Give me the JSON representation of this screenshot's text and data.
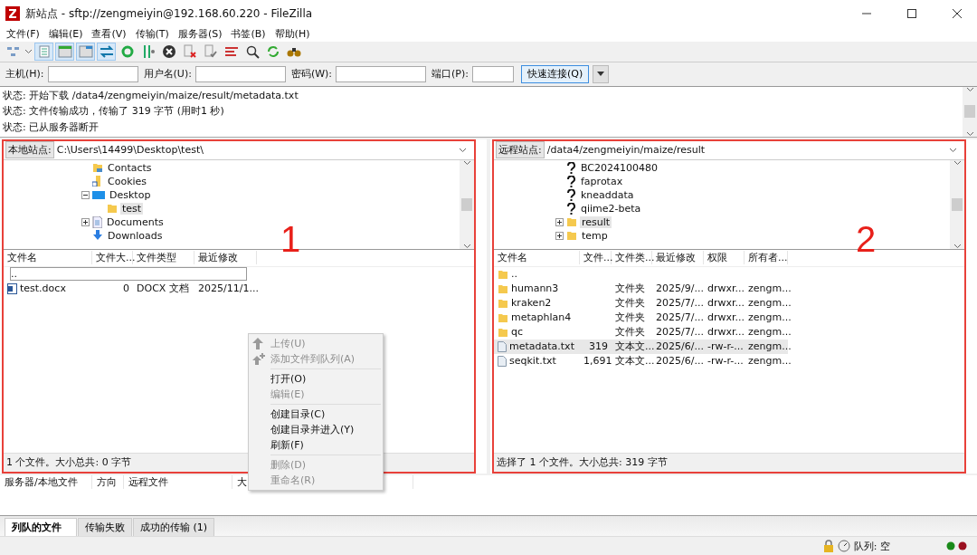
{
  "window": {
    "title": "新站点 - sftp://zengmeiyin@192.168.60.220 - FileZilla"
  },
  "menu": [
    "文件(F)",
    "编辑(E)",
    "查看(V)",
    "传输(T)",
    "服务器(S)",
    "书签(B)",
    "帮助(H)"
  ],
  "quickconnect": {
    "fields": [
      {
        "label": "主机(H):"
      },
      {
        "label": "用户名(U):"
      },
      {
        "label": "密码(W):"
      },
      {
        "label": "端口(P):"
      }
    ],
    "button": "快速连接(Q)"
  },
  "log": [
    "状态: 开始下载 /data4/zengmeiyin/maize/result/metadata.txt",
    "状态: 文件传输成功，传输了 319 字节 (用时1 秒)",
    "状态: 已从服务器断开"
  ],
  "panes": [
    {
      "site_label": "本地站点:",
      "path": "C:\\Users\\14499\\Desktop\\test\\",
      "annotation": "1",
      "tree": [
        {
          "label": "Contacts",
          "kind": "contacts",
          "selected": false
        },
        {
          "label": "Cookies",
          "kind": "shortcut",
          "selected": false
        },
        {
          "label": "Desktop",
          "kind": "desktop",
          "selected": false,
          "expanded": true,
          "children": [
            {
              "label": "test",
              "kind": "folder",
              "selected": true
            }
          ]
        },
        {
          "label": "Documents",
          "kind": "document",
          "selected": false,
          "expanded": false
        },
        {
          "label": "Downloads",
          "kind": "download",
          "selected": false
        }
      ],
      "columns": [
        "文件名",
        "文件大...",
        "文件类型",
        "最近修改"
      ],
      "rows": [
        {
          "kind": "parent",
          "selected": false,
          "editing": true,
          "cells": [
            "..",
            "",
            "",
            ""
          ]
        },
        {
          "kind": "docx",
          "selected": false,
          "editing": false,
          "cells": [
            "test.docx",
            "0",
            "DOCX 文档",
            "2025/11/1..."
          ]
        }
      ],
      "status": "1 个文件。大小总共: 0 字节"
    },
    {
      "site_label": "远程站点:",
      "path": "/data4/zengmeiyin/maize/result",
      "annotation": "2",
      "tree": [
        {
          "label": "BC2024100480",
          "kind": "unknown",
          "selected": false
        },
        {
          "label": "faprotax",
          "kind": "unknown",
          "selected": false
        },
        {
          "label": "kneaddata",
          "kind": "unknown",
          "selected": false
        },
        {
          "label": "qiime2-beta",
          "kind": "unknown",
          "selected": false
        },
        {
          "label": "result",
          "kind": "folder",
          "selected": true,
          "expanded": false
        },
        {
          "label": "temp",
          "kind": "folder",
          "selected": false,
          "expanded": false
        }
      ],
      "columns": [
        "文件名",
        "文件...",
        "文件类...",
        "最近修改",
        "权限",
        "所有者..."
      ],
      "rows": [
        {
          "kind": "parent",
          "selected": false,
          "editing": false,
          "cells": [
            "..",
            "",
            "",
            "",
            "",
            ""
          ]
        },
        {
          "kind": "folder",
          "selected": false,
          "editing": false,
          "cells": [
            "humann3",
            "",
            "文件夹",
            "2025/9/...",
            "drwxr...",
            "zengm..."
          ]
        },
        {
          "kind": "folder",
          "selected": false,
          "editing": false,
          "cells": [
            "kraken2",
            "",
            "文件夹",
            "2025/7/...",
            "drwxr...",
            "zengm..."
          ]
        },
        {
          "kind": "folder",
          "selected": false,
          "editing": false,
          "cells": [
            "metaphlan4",
            "",
            "文件夹",
            "2025/7/...",
            "drwxr...",
            "zengm..."
          ]
        },
        {
          "kind": "folder",
          "selected": false,
          "editing": false,
          "cells": [
            "qc",
            "",
            "文件夹",
            "2025/7/...",
            "drwxr...",
            "zengm..."
          ]
        },
        {
          "kind": "txt",
          "selected": true,
          "editing": false,
          "cells": [
            "metadata.txt",
            "319",
            "文本文...",
            "2025/6/...",
            "-rw-r-...",
            "zengm..."
          ]
        },
        {
          "kind": "txt",
          "selected": false,
          "editing": false,
          "cells": [
            "seqkit.txt",
            "1,691",
            "文本文...",
            "2025/6/...",
            "-rw-r-...",
            "zengm..."
          ]
        }
      ],
      "status": "选择了 1 个文件。大小总共: 319 字节"
    }
  ],
  "context_menu": [
    {
      "kind": "upload",
      "label": "上传(U)",
      "disabled": true
    },
    {
      "kind": "queue",
      "label": "添加文件到队列(A)",
      "disabled": true
    },
    {
      "kind": "separator"
    },
    {
      "kind": "item",
      "label": "打开(O)",
      "disabled": false
    },
    {
      "kind": "item",
      "label": "编辑(E)",
      "disabled": true
    },
    {
      "kind": "separator"
    },
    {
      "kind": "item",
      "label": "创建目录(C)",
      "disabled": false
    },
    {
      "kind": "item",
      "label": "创建目录并进入(Y)",
      "disabled": false
    },
    {
      "kind": "item",
      "label": "刷新(F)",
      "disabled": false
    },
    {
      "kind": "separator"
    },
    {
      "kind": "item",
      "label": "删除(D)",
      "disabled": true
    },
    {
      "kind": "item",
      "label": "重命名(R)",
      "disabled": true
    }
  ],
  "queue": {
    "columns": [
      "服务器/本地文件",
      "方向",
      "远程文件",
      "大"
    ]
  },
  "tabs": [
    {
      "label": "列队的文件",
      "selected": true
    },
    {
      "label": "传输失败",
      "selected": false
    },
    {
      "label": "成功的传输 (1)",
      "selected": false
    }
  ],
  "status_bar": {
    "queue": "队列: 空"
  }
}
